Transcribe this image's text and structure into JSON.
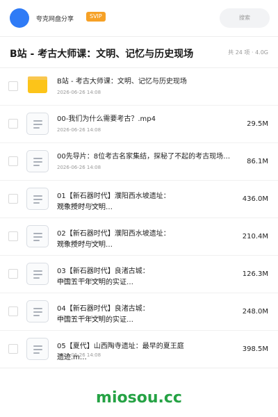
{
  "header": {
    "site_name": "夸克网盘分享",
    "badge": "SVIP",
    "search_placeholder": "搜索"
  },
  "title_bar": {
    "title": "B站 - 考古大师课：文明、记忆与历史现场",
    "summary": "共 24 项 · 4.0G"
  },
  "files": [
    {
      "name_line1": "B站 - 考古大师课：文明、记忆与历史现场",
      "name_line2": "",
      "date": "2026-06-26 14:08",
      "size": "",
      "icon": "folder-icon"
    },
    {
      "name_line1": "00-我们为什么需要考古？.mp4",
      "name_line2": "",
      "date": "2026-06-26 14:08",
      "size": "29.5M",
      "icon": "file-icon"
    },
    {
      "name_line1": "00先导片：8位考古名家集结，探秘了不起的考古现场…",
      "name_line2": "",
      "date": "2026-06-26 14:08",
      "size": "86.1M",
      "icon": "file-icon"
    },
    {
      "name_line1": "01【新石器时代】濮阳西水坡遗址：",
      "name_line2": "观象授时与文明…",
      "date": "2026-06-26 14:08",
      "size": "436.0M",
      "icon": "file-icon"
    },
    {
      "name_line1": "02【新石器时代】濮阳西水坡遗址：",
      "name_line2": "观象授时与文明…",
      "date": "2026-06-26 14:08",
      "size": "210.4M",
      "icon": "file-icon"
    },
    {
      "name_line1": "03【新石器时代】良渚古城：",
      "name_line2": "中国五千年文明的实证…",
      "date": "2026-06-26 14:08",
      "size": "126.3M",
      "icon": "file-icon"
    },
    {
      "name_line1": "04【新石器时代】良渚古城：",
      "name_line2": "中国五千年文明的实证…",
      "date": "2026-06-26 14:08",
      "size": "248.0M",
      "icon": "file-icon"
    },
    {
      "name_line1": "05【夏代】山西陶寺遗址：最早的夏王庭",
      "name_line2": "遗迹.m…",
      "date": "2026-06-26 14:08",
      "size": "398.5M",
      "icon": "file-icon"
    }
  ],
  "watermark": "miosou.cc",
  "colors": {
    "avatar": "#2f7bf6",
    "badge": "#f6a126",
    "folder": "#fcc419",
    "watermark": "#25a244"
  }
}
